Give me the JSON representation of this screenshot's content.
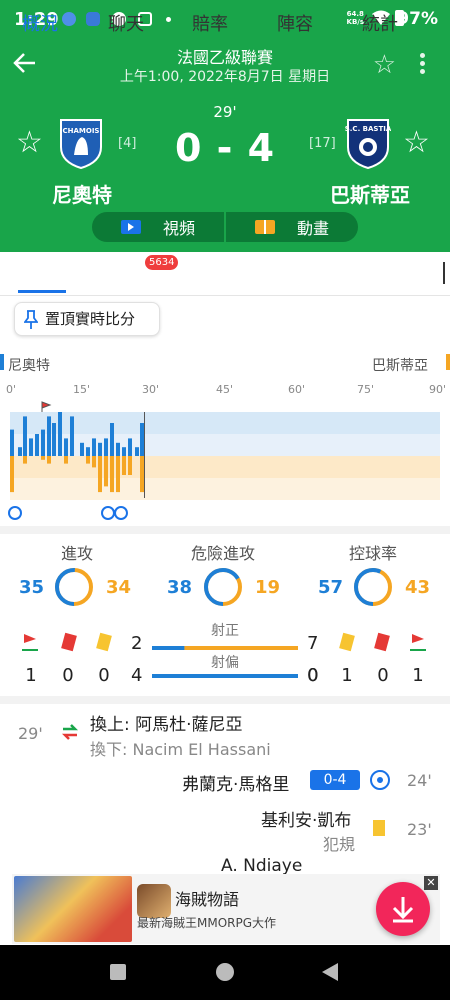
{
  "status": {
    "time": "1:29",
    "net_speed_value": "64.8",
    "net_speed_unit": "KB/s",
    "battery": "97%"
  },
  "header": {
    "league": "法國乙級聯賽",
    "datetime": "上午1:00, 2022年8月7日 星期日",
    "minute": "29'",
    "score": "0 - 4"
  },
  "home": {
    "name": "尼奧特",
    "rank": "[4]",
    "crest_text": "CHAMOIS",
    "color": "#1e7fd6"
  },
  "away": {
    "name": "巴斯蒂亞",
    "rank": "[17]",
    "crest_text": "S.C. BASTIA",
    "color": "#f5a623"
  },
  "media": {
    "video": "視頻",
    "animation": "動畫"
  },
  "tabs": [
    {
      "label": "概況",
      "active": true
    },
    {
      "label": "聊天",
      "badge": "5634"
    },
    {
      "label": "賠率"
    },
    {
      "label": "陣容"
    },
    {
      "label": "統計"
    }
  ],
  "pin_label": "置頂實時比分",
  "timeline_ticks": [
    "0'",
    "15'",
    "30'",
    "45'",
    "60'",
    "75'",
    "90'"
  ],
  "timeline": {
    "home_bars": [
      [
        10,
        0.6
      ],
      [
        18,
        0.2
      ],
      [
        23,
        0.9
      ],
      [
        29,
        0.4
      ],
      [
        35,
        0.5
      ],
      [
        41,
        0.6
      ],
      [
        47,
        0.9
      ],
      [
        52,
        0.75
      ],
      [
        58,
        1.0
      ],
      [
        64,
        0.4
      ],
      [
        70,
        0.9
      ],
      [
        80,
        0.3
      ],
      [
        86,
        0.2
      ],
      [
        92,
        0.4
      ],
      [
        98,
        0.3
      ],
      [
        104,
        0.4
      ],
      [
        110,
        0.75
      ],
      [
        116,
        0.3
      ],
      [
        122,
        0.2
      ],
      [
        128,
        0.4
      ],
      [
        135,
        0.2
      ],
      [
        140,
        0.75
      ]
    ],
    "away_bars": [
      [
        10,
        0.95
      ],
      [
        23,
        0.2
      ],
      [
        41,
        0.1
      ],
      [
        47,
        0.2
      ],
      [
        64,
        0.2
      ],
      [
        86,
        0.2
      ],
      [
        92,
        0.3
      ],
      [
        98,
        0.95
      ],
      [
        104,
        0.8
      ],
      [
        110,
        0.95
      ],
      [
        116,
        0.95
      ],
      [
        122,
        0.5
      ],
      [
        128,
        0.5
      ],
      [
        140,
        0.95
      ]
    ]
  },
  "stats": {
    "attack": {
      "label": "進攻",
      "home": 35,
      "away": 34
    },
    "dangerous": {
      "label": "危險進攻",
      "home": 38,
      "away": 19
    },
    "possession": {
      "label": "控球率",
      "home": 57,
      "away": 43
    }
  },
  "cards": {
    "home": {
      "corners": "1",
      "red": "0",
      "yellow": "0"
    },
    "away": {
      "yellow": "0",
      "red": "1",
      "corners": "1"
    }
  },
  "shots": {
    "on_target": {
      "label": "射正",
      "home": "2",
      "away": "7"
    },
    "off_target": {
      "label": "射偏",
      "home": "4",
      "away": "0"
    }
  },
  "events": {
    "sub": {
      "minute": "29'",
      "in": "換上: 阿馬杜·薩尼亞",
      "out": "換下: Nacim El Hassani"
    },
    "goal1": {
      "player": "弗蘭克·馬格里",
      "score": "0-4",
      "minute": "24'"
    },
    "card1": {
      "player": "基利安·凱布",
      "reason": "犯規",
      "minute": "23'"
    },
    "goal2": {
      "player": "A. Ndiaye"
    }
  },
  "ad": {
    "title": "海賊物語",
    "subtitle": "最新海賊王MMORPG大作"
  }
}
